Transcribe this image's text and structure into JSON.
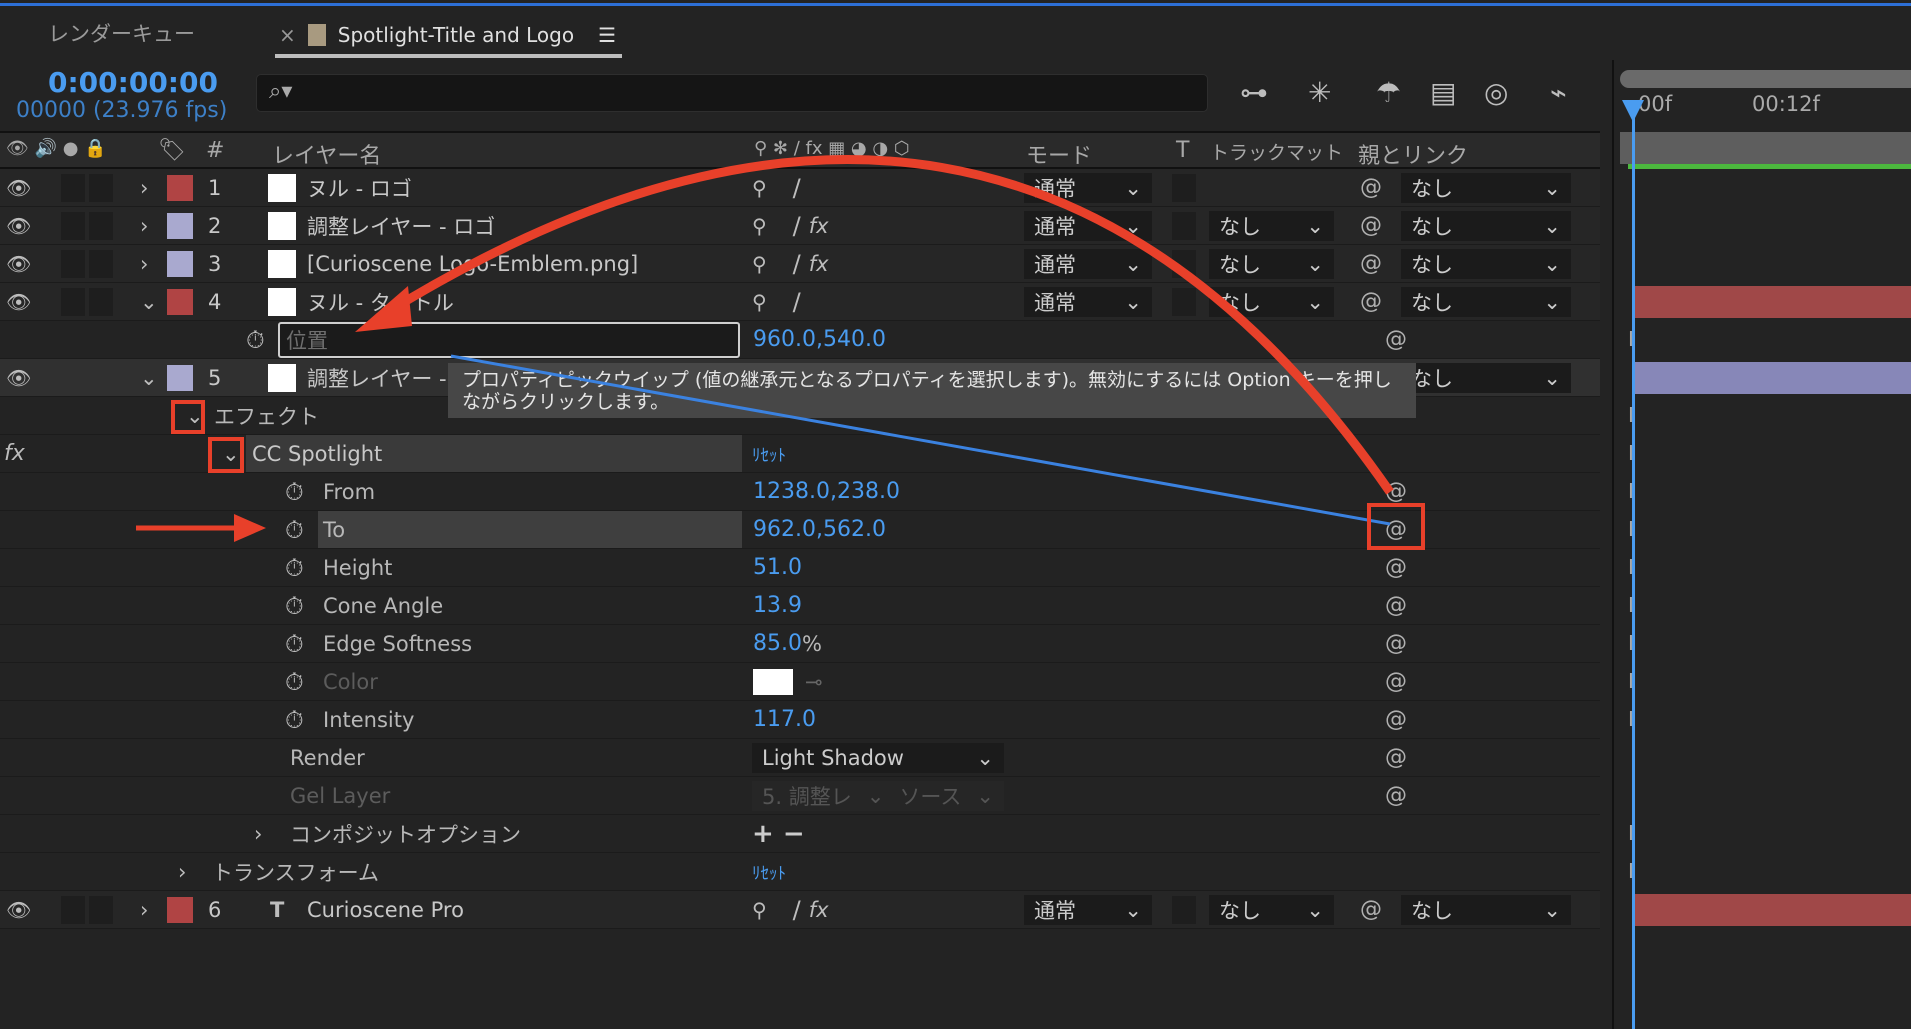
{
  "tabs": {
    "render_queue": "レンダーキュー",
    "close": "×",
    "comp": "Spotlight-Title and Logo",
    "menu": "☰"
  },
  "time": {
    "timecode": "0:00:00:00",
    "frames": "00000 (23.976 fps)"
  },
  "search": {
    "icon": "⌕▾"
  },
  "toolbar": [
    "⊶",
    "✳",
    "☂",
    "▤",
    "◎",
    "⌁"
  ],
  "header": {
    "switch_icons": "👁 🔊 ● 🔒",
    "label": "🏷",
    "num": "#",
    "layer_name": "レイヤー名",
    "switches": "⚲ ✻ ∕ fx ▦ ◕ ◑ ⬡",
    "mode": "モード",
    "t": "T",
    "track_matte": "トラックマット",
    "parent": "親とリンク"
  },
  "timeline": {
    "t0": "00f",
    "t1": "00:12f",
    "playhead_color": "#4a9cf0"
  },
  "colors": {
    "red_label": "#b04444",
    "lavender_label": "#a9a9cf",
    "accent": "#4a9cf0",
    "annotation": "#e8402a"
  },
  "layers": [
    {
      "num": "1",
      "name": "ヌル - ロゴ",
      "label": "#b04444",
      "mode": "通常",
      "matte": "",
      "parent": "なし",
      "fx": false,
      "open": false
    },
    {
      "num": "2",
      "name": "調整レイヤー - ロゴ",
      "label": "#a9a9cf",
      "mode": "通常",
      "matte": "なし",
      "parent": "なし",
      "fx": true,
      "open": false
    },
    {
      "num": "3",
      "name": "[Curioscene Logo-Emblem.png]",
      "label": "#a9a9cf",
      "mode": "通常",
      "matte": "なし",
      "parent": "なし",
      "fx": true,
      "open": false
    },
    {
      "num": "4",
      "name": "ヌル - タイトル",
      "label": "#b04444",
      "mode": "通常",
      "matte": "なし",
      "parent": "なし",
      "fx": false,
      "open": true
    }
  ],
  "position_prop": {
    "name": "位置",
    "value": "960.0,540.0"
  },
  "layer5": {
    "num": "5",
    "name": "調整レイヤー - ライト",
    "parent": "なし"
  },
  "tooltip": "プロパティピックウイップ (値の継承元となるプロパティを選択します)。無効にするには Option キーを押しながらクリックします。",
  "effects": {
    "label": "エフェクト",
    "fx": "fx",
    "name": "CC Spotlight",
    "reset": "ﾘｾｯﾄ",
    "props": [
      {
        "name": "From",
        "value": "1238.0,238.0"
      },
      {
        "name": "To",
        "value": "962.0,562.0"
      },
      {
        "name": "Height",
        "value": "51.0"
      },
      {
        "name": "Cone Angle",
        "value": "13.9"
      },
      {
        "name": "Edge Softness",
        "value": "85.0",
        "unit": "%"
      },
      {
        "name": "Color",
        "value": "#ffffff"
      },
      {
        "name": "Intensity",
        "value": "117.0"
      }
    ],
    "render": {
      "name": "Render",
      "value": "Light Shadow"
    },
    "gel": {
      "name": "Gel Layer",
      "layer": "5. 調整レ",
      "source": "ソース"
    },
    "composite": "コンポジットオプション",
    "addremove": "+ −"
  },
  "transform": {
    "label": "トランスフォーム",
    "reset": "ﾘｾｯﾄ"
  },
  "layer6": {
    "num": "6",
    "name": "Curioscene Pro",
    "mode": "通常",
    "matte": "なし",
    "parent": "なし",
    "icon": "T"
  }
}
